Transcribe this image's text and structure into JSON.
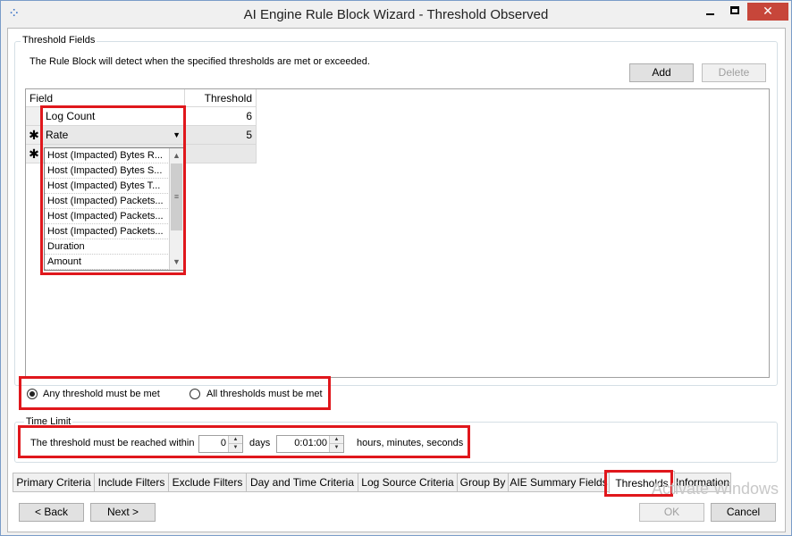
{
  "window": {
    "title": "AI Engine Rule Block Wizard - Threshold Observed",
    "controls": {
      "minimize": "minimize",
      "maximize": "maximize",
      "close": "✕"
    }
  },
  "threshold_fields": {
    "legend": "Threshold Fields",
    "description": "The Rule Block will detect when the specified thresholds are met or exceeded.",
    "add_label": "Add",
    "delete_label": "Delete",
    "columns": {
      "field": "Field",
      "threshold": "Threshold"
    },
    "rows": [
      {
        "field": "Log Count",
        "threshold": "6",
        "marker": ""
      },
      {
        "field": "Rate",
        "threshold": "5",
        "marker": "✱"
      },
      {
        "field": "",
        "threshold": "",
        "marker": "✱"
      }
    ],
    "dropdown_options": [
      "Host (Impacted) Bytes R...",
      "Host (Impacted) Bytes S...",
      "Host (Impacted) Bytes T...",
      "Host (Impacted) Packets...",
      "Host (Impacted) Packets...",
      "Host (Impacted) Packets...",
      "Duration",
      "Amount"
    ]
  },
  "threshold_mode": {
    "any_label": "Any threshold must be met",
    "all_label": "All thresholds must be met",
    "selected": "any"
  },
  "time_limit": {
    "legend": "Time Limit",
    "prefix": "The threshold must be reached within",
    "days_value": "0",
    "days_label": "days",
    "time_value": "0:01:00",
    "time_label": "hours, minutes, seconds"
  },
  "tabs": [
    {
      "label": "Primary Criteria",
      "active": false
    },
    {
      "label": "Include Filters",
      "active": false
    },
    {
      "label": "Exclude Filters",
      "active": false
    },
    {
      "label": "Day and Time Criteria",
      "active": false
    },
    {
      "label": "Log Source Criteria",
      "active": false
    },
    {
      "label": "Group By",
      "active": false
    },
    {
      "label": "AIE Summary Fields",
      "active": false
    },
    {
      "label": "Thresholds",
      "active": true
    },
    {
      "label": "Information",
      "active": false
    }
  ],
  "footer": {
    "back_label": "< Back",
    "next_label": "Next >",
    "ok_label": "OK",
    "cancel_label": "Cancel"
  },
  "watermark": "Activate Windows",
  "colors": {
    "highlight_box": "#e0171c",
    "close_button": "#c7463a"
  }
}
